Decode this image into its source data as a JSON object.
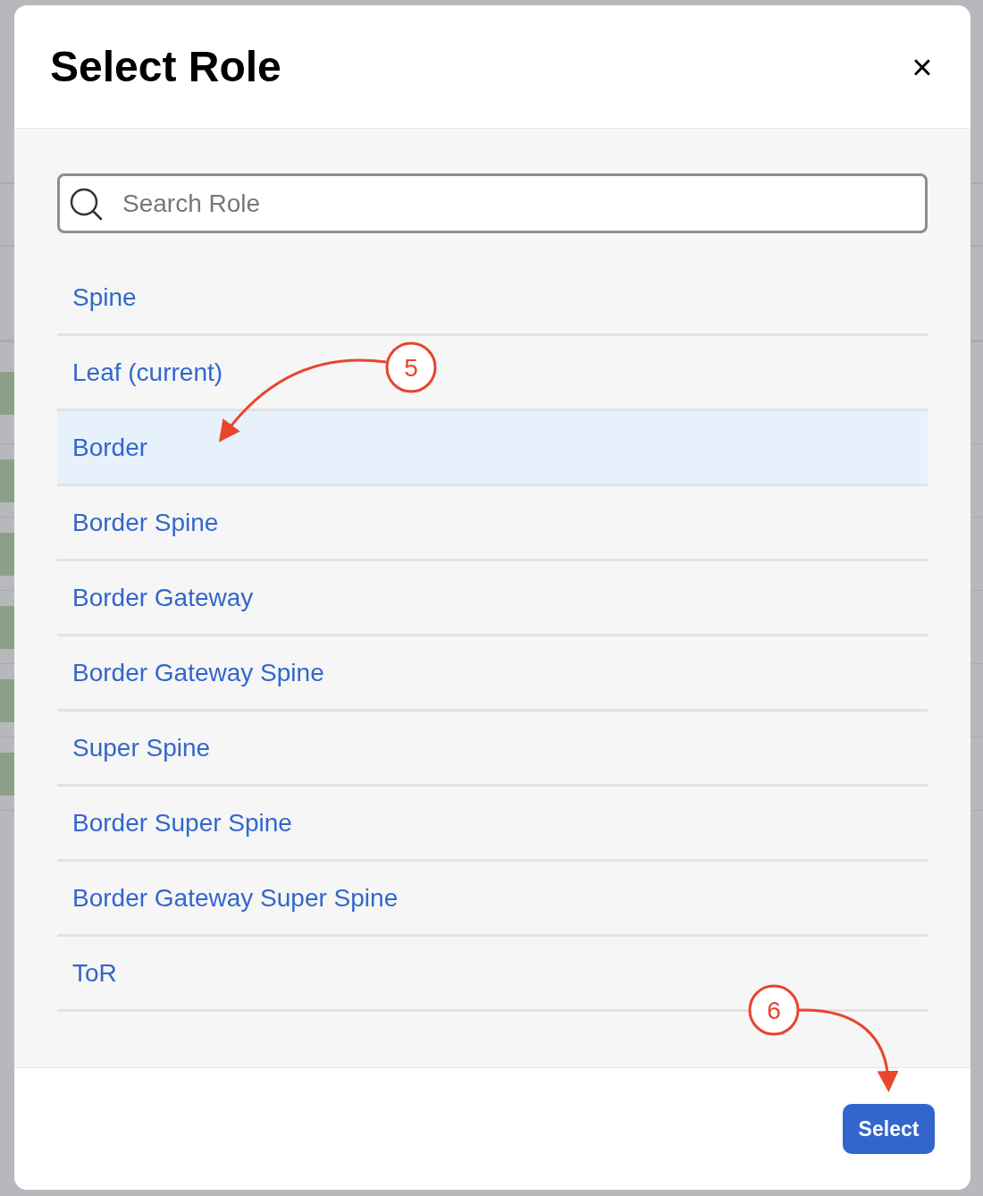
{
  "dialog": {
    "title": "Select Role",
    "close_icon": "×"
  },
  "search": {
    "placeholder": "Search Role"
  },
  "roles": [
    {
      "label": "Spine",
      "selected": false
    },
    {
      "label": "Leaf (current)",
      "selected": false
    },
    {
      "label": "Border",
      "selected": true
    },
    {
      "label": "Border Spine",
      "selected": false
    },
    {
      "label": "Border Gateway",
      "selected": false
    },
    {
      "label": "Border Gateway Spine",
      "selected": false
    },
    {
      "label": "Super Spine",
      "selected": false
    },
    {
      "label": "Border Super Spine",
      "selected": false
    },
    {
      "label": "Border Gateway Super Spine",
      "selected": false
    },
    {
      "label": "ToR",
      "selected": false
    }
  ],
  "footer": {
    "button": "Select"
  },
  "annotations": [
    {
      "label": "5"
    },
    {
      "label": "6"
    }
  ]
}
